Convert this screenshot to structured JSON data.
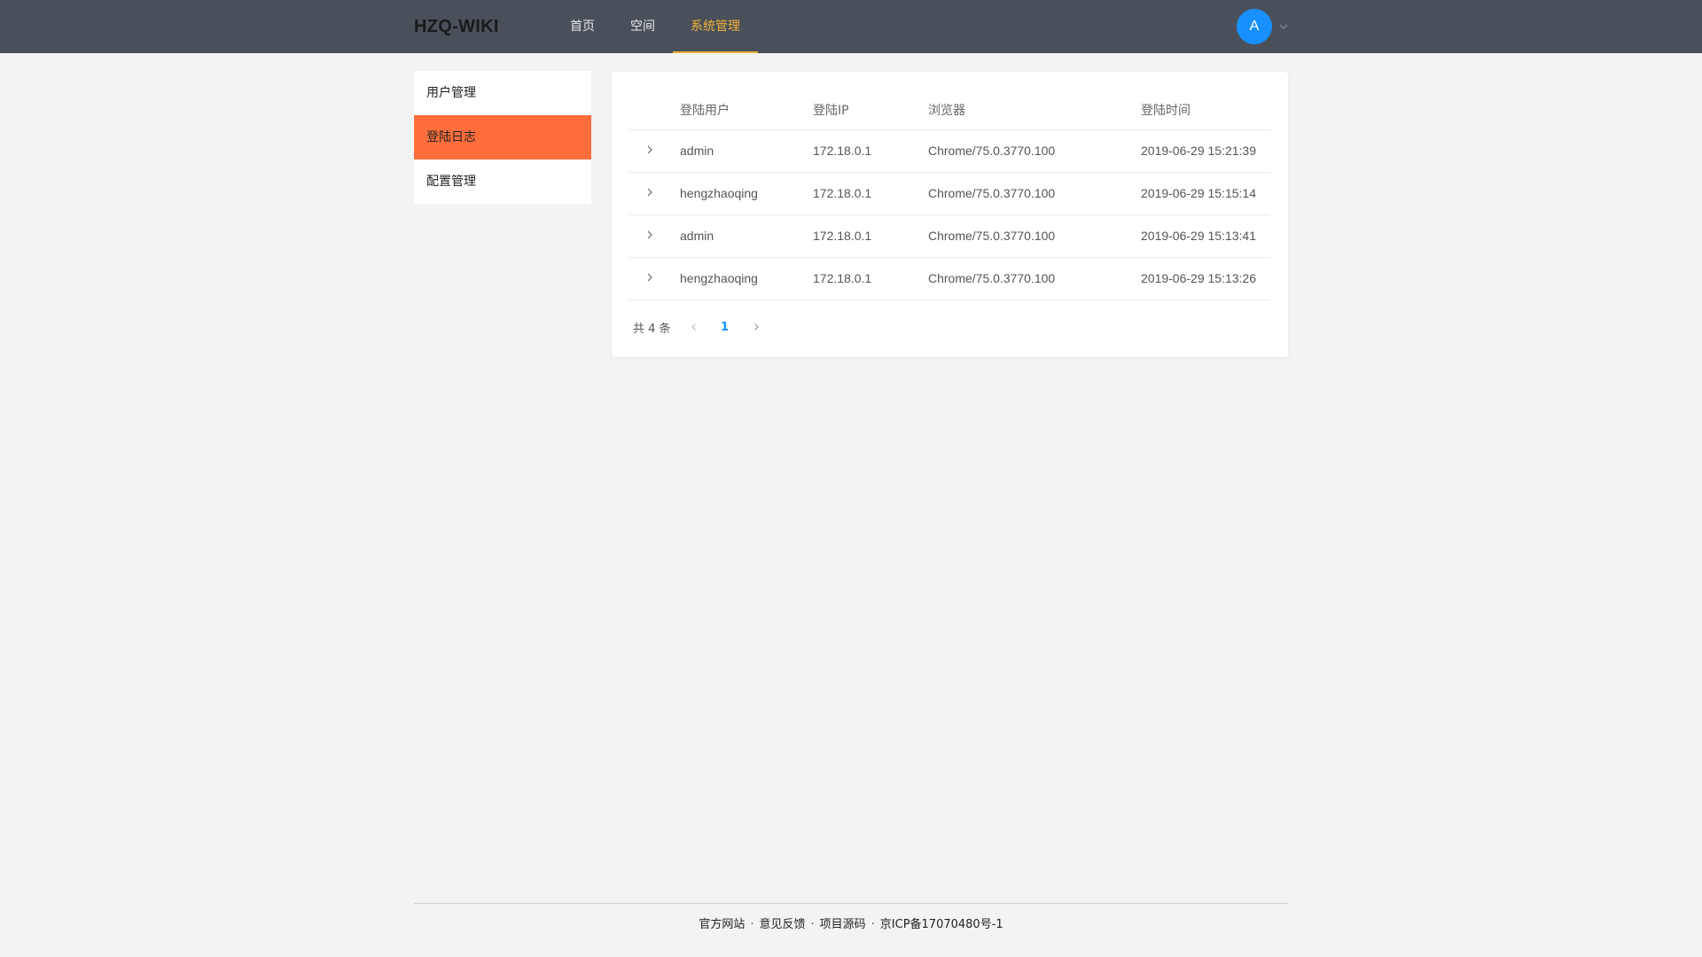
{
  "header": {
    "logo": "HZQ-WIKI",
    "nav": [
      {
        "label": "首页"
      },
      {
        "label": "空间"
      },
      {
        "label": "系统管理"
      }
    ],
    "avatar_letter": "A",
    "accent_color": "#f0b23a"
  },
  "sidebar": {
    "items": [
      {
        "label": "用户管理"
      },
      {
        "label": "登陆日志"
      },
      {
        "label": "配置管理"
      }
    ],
    "active_color": "#ff6e3b"
  },
  "table": {
    "headers": [
      "登陆用户",
      "登陆IP",
      "浏览器",
      "登陆时间"
    ],
    "rows": [
      {
        "user": "admin",
        "ip": "172.18.0.1",
        "browser": "Chrome/75.0.3770.100",
        "time": "2019-06-29 15:21:39"
      },
      {
        "user": "hengzhaoqing",
        "ip": "172.18.0.1",
        "browser": "Chrome/75.0.3770.100",
        "time": "2019-06-29 15:15:14"
      },
      {
        "user": "admin",
        "ip": "172.18.0.1",
        "browser": "Chrome/75.0.3770.100",
        "time": "2019-06-29 15:13:41"
      },
      {
        "user": "hengzhaoqing",
        "ip": "172.18.0.1",
        "browser": "Chrome/75.0.3770.100",
        "time": "2019-06-29 15:13:26"
      }
    ]
  },
  "pagination": {
    "total": "共 4 条",
    "current_page": "1"
  },
  "footer": {
    "links": [
      "官方网站",
      "意见反馈",
      "项目源码",
      "京ICP备17070480号-1"
    ],
    "separator": "·"
  }
}
